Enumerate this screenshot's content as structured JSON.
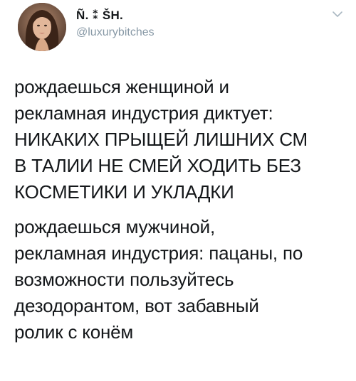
{
  "tweet": {
    "author": {
      "display_name": "Ñ. ⁑ ŠH.",
      "handle": "@luxurybitches",
      "avatar_icon": "profile-photo"
    },
    "menu_icon": "chevron-down-icon",
    "paragraphs": [
      "рождаешься женщиной и\nрекламная индустрия диктует:\nНИКАКИХ ПРЫЩЕЙ ЛИШНИХ СМ\nВ ТАЛИИ НЕ СМЕЙ ХОДИТЬ БЕЗ\nКОСМЕТИКИ И УКЛАДКИ",
      "рождаешься мужчиной,\nрекламная индустрия: пацаны, по\nвозможности пользуйтесь\nдезодорантом, вот забавный\nролик с конём"
    ]
  },
  "colors": {
    "text": "#14171a",
    "secondary_text": "#8899a6",
    "background": "#ffffff"
  }
}
